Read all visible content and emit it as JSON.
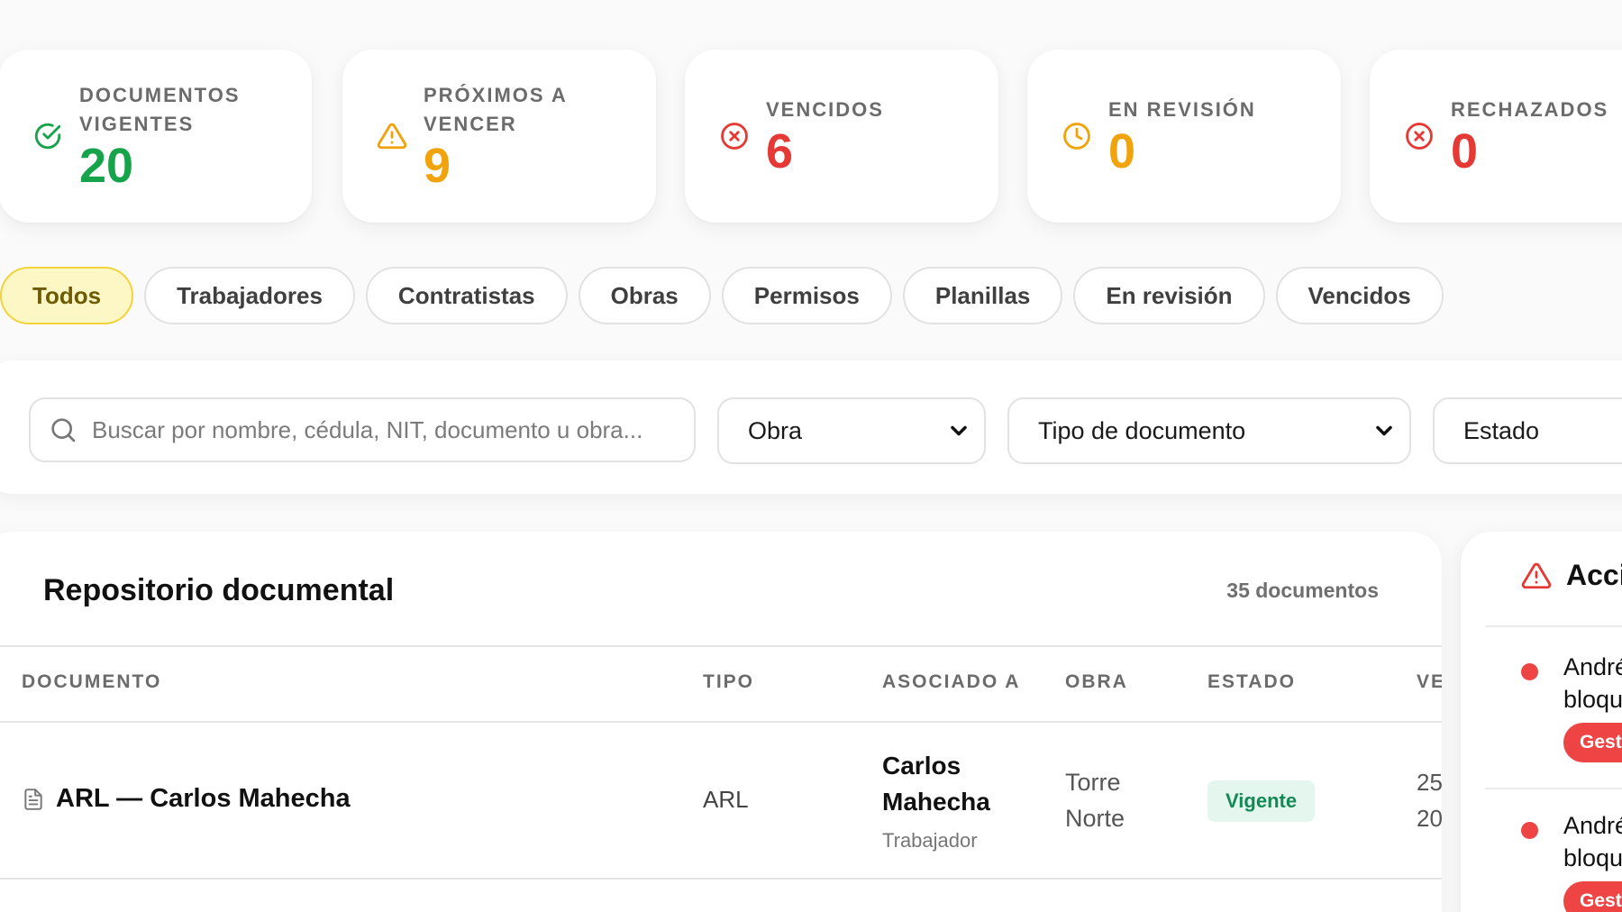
{
  "colors": {
    "green": "#16a34a",
    "amber": "#f0a30a",
    "red": "#e53935",
    "chip_active_bg": "#fdf7c6",
    "badge_green": "#138a55"
  },
  "stats": [
    {
      "label": "DOCUMENTOS\nVIGENTES",
      "value": "20",
      "icon": "check-circle-icon",
      "color": "#16a34a"
    },
    {
      "label": "PRÓXIMOS A\nVENCER",
      "value": "9",
      "icon": "warning-triangle-icon",
      "color": "#f0a30a"
    },
    {
      "label": "VENCIDOS",
      "value": "6",
      "icon": "x-circle-icon",
      "color": "#e53935"
    },
    {
      "label": "EN REVISIÓN",
      "value": "0",
      "icon": "clock-icon",
      "color": "#f0a30a"
    },
    {
      "label": "RECHAZADOS",
      "value": "0",
      "icon": "x-circle-icon",
      "color": "#e53935"
    }
  ],
  "chips": [
    {
      "label": "Todos",
      "active": true
    },
    {
      "label": "Trabajadores",
      "active": false
    },
    {
      "label": "Contratistas",
      "active": false
    },
    {
      "label": "Obras",
      "active": false
    },
    {
      "label": "Permisos",
      "active": false
    },
    {
      "label": "Planillas",
      "active": false
    },
    {
      "label": "En revisión",
      "active": false
    },
    {
      "label": "Vencidos",
      "active": false
    }
  ],
  "filters": {
    "search_placeholder": "Buscar por nombre, cédula, NIT, documento u obra...",
    "obra": "Obra",
    "tipo": "Tipo de documento",
    "estado": "Estado"
  },
  "repository": {
    "title": "Repositorio documental",
    "count": "35 documentos",
    "columns": [
      "DOCUMENTO",
      "TIPO",
      "ASOCIADO A",
      "OBRA",
      "ESTADO",
      "VE"
    ],
    "rows": [
      {
        "document": "ARL — Carlos Mahecha",
        "type": "ARL",
        "associated_name": "Carlos\nMahecha",
        "associated_role": "Trabajador",
        "obra": "Torre\nNorte",
        "status": "Vigente",
        "date": "25\n20"
      }
    ]
  },
  "side": {
    "title": "Acci",
    "alerts": [
      {
        "text": "André\nbloque",
        "button": "Gesti"
      },
      {
        "text": "André\nbloque",
        "button": "Gesti"
      }
    ]
  }
}
